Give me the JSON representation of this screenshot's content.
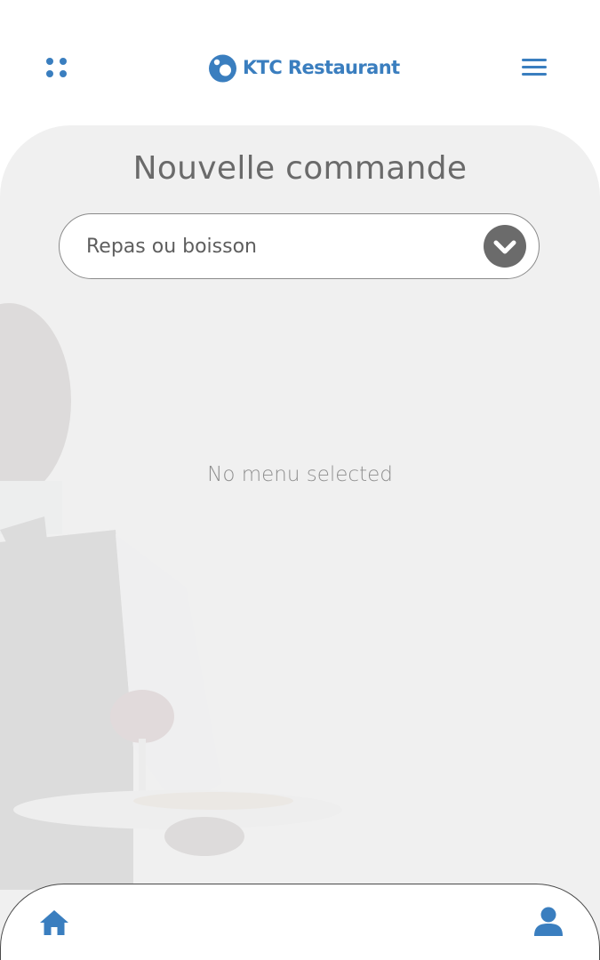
{
  "theme": {
    "accent": "#3a7ebf",
    "chevron": "#6b6b6b",
    "panel_background": "#f0f0f0"
  },
  "header": {
    "apps_icon": "grid-dots-icon",
    "brand_name": "KTC Restaurant",
    "menu_icon": "hamburger-menu-icon"
  },
  "main": {
    "title": "Nouvelle commande",
    "select": {
      "value": "Repas ou boisson",
      "icon": "chevron-down-icon"
    },
    "empty_message": "No menu selected",
    "background_image": "waiter-serving-plate"
  },
  "bottom_nav": {
    "home_icon": "home-icon",
    "profile_icon": "user-icon"
  }
}
